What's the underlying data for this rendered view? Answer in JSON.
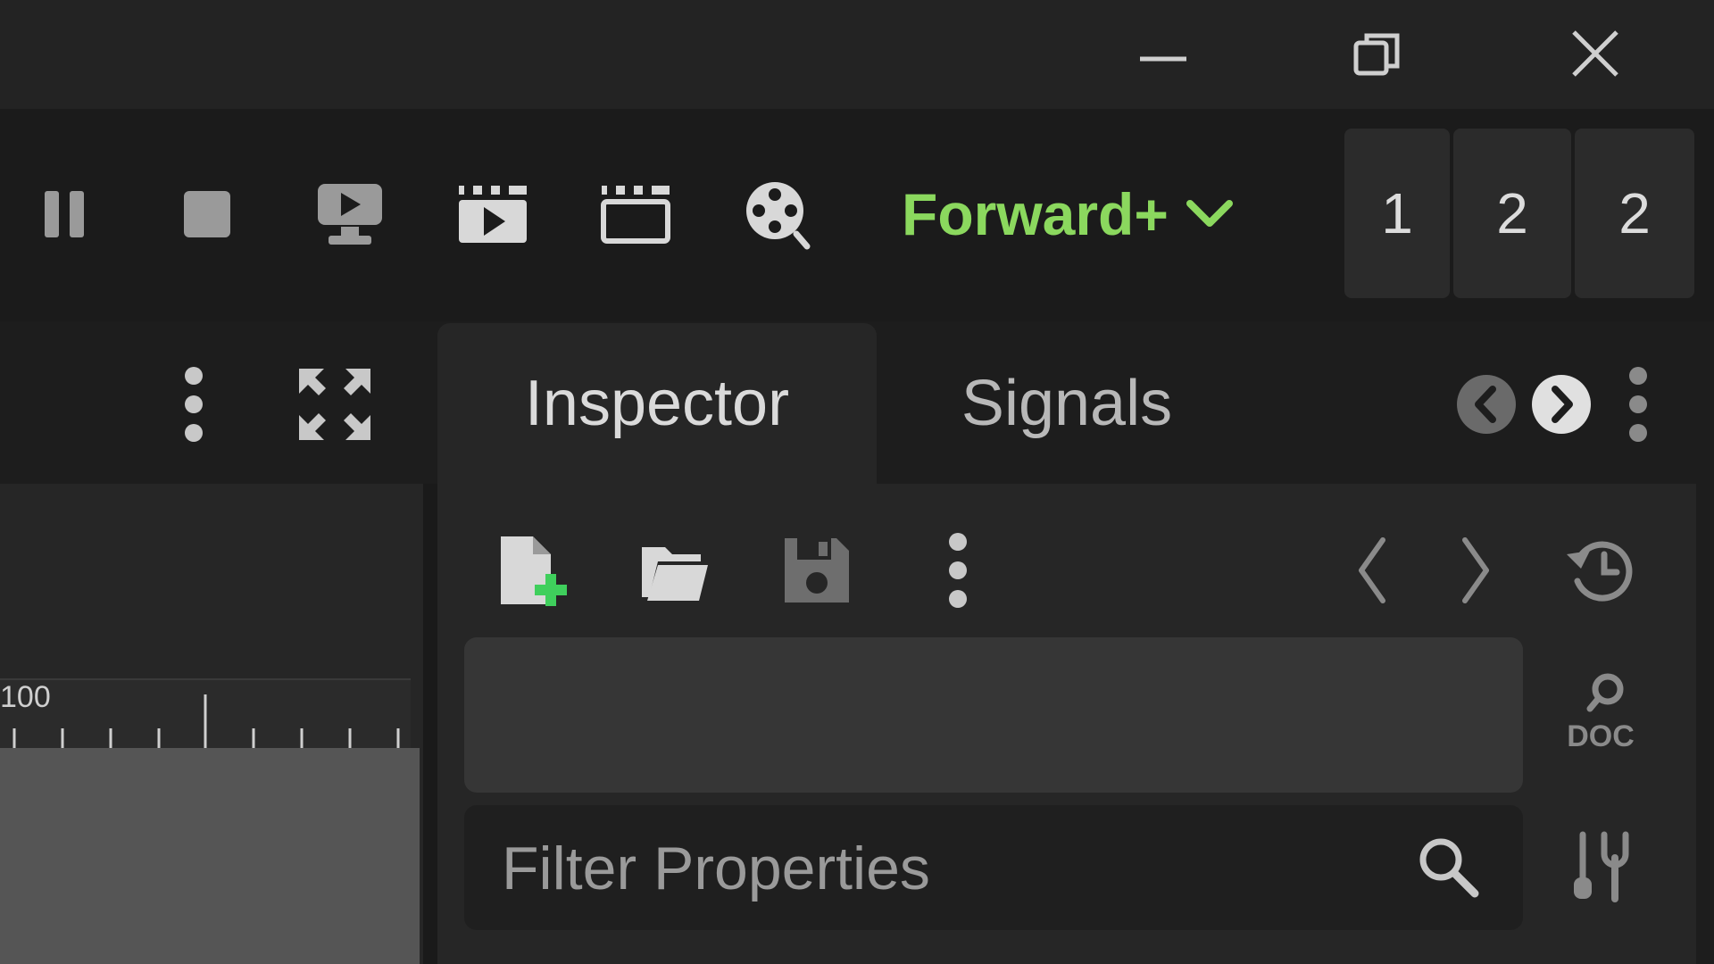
{
  "window_controls": {
    "minimize_icon": "minimize-icon",
    "restore_icon": "restore-icon",
    "close_icon": "close-icon"
  },
  "run_toolbar": {
    "icons": [
      "pause-icon",
      "stop-icon",
      "remote-debug-icon",
      "play-scene-icon",
      "play-custom-scene-icon",
      "movie-maker-icon"
    ]
  },
  "renderer": {
    "label": "Forward+",
    "color": "#8bd85e"
  },
  "counters": [
    "1",
    "2",
    "2"
  ],
  "viewport": {
    "ruler_label": "100"
  },
  "dock": {
    "tabs": [
      {
        "label": "Inspector",
        "active": true
      },
      {
        "label": "Signals",
        "active": false
      }
    ]
  },
  "inspector": {
    "filter_placeholder": "Filter Properties",
    "toolbar_icons": [
      "new-resource-icon",
      "load-resource-icon",
      "save-resource-icon",
      "more-options-icon",
      "history-back-icon",
      "history-forward-icon",
      "object-history-icon"
    ],
    "side_icons": [
      "open-documentation-icon",
      "property-filter-options-icon"
    ]
  }
}
